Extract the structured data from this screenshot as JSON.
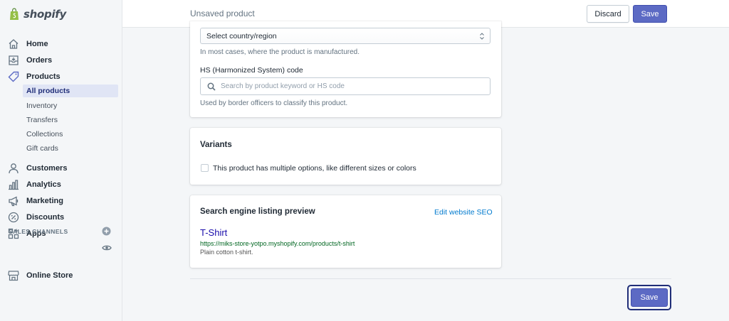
{
  "brand": {
    "name": "shopify",
    "color": "#95bf47"
  },
  "header": {
    "title": "Unsaved product",
    "discard_label": "Discard",
    "save_label": "Save"
  },
  "sidebar": {
    "items": [
      {
        "label": "Home",
        "icon": "home-icon"
      },
      {
        "label": "Orders",
        "icon": "orders-icon"
      },
      {
        "label": "Products",
        "icon": "tag-icon"
      },
      {
        "label": "Customers",
        "icon": "person-icon"
      },
      {
        "label": "Analytics",
        "icon": "bar-chart-icon"
      },
      {
        "label": "Marketing",
        "icon": "megaphone-icon"
      },
      {
        "label": "Discounts",
        "icon": "discount-icon"
      },
      {
        "label": "Apps",
        "icon": "apps-icon"
      }
    ],
    "product_subitems": [
      "All products",
      "Inventory",
      "Transfers",
      "Collections",
      "Gift cards"
    ],
    "active_subitem": "All products",
    "sales_channels_header": "SALES CHANNELS",
    "online_store_label": "Online Store"
  },
  "customs": {
    "country_select_value": "Select country/region",
    "country_help": "In most cases, where the product is manufactured.",
    "hs_label": "HS (Harmonized System) code",
    "hs_placeholder": "Search by product keyword or HS code",
    "hs_help": "Used by border officers to classify this product."
  },
  "variants": {
    "title": "Variants",
    "checkbox_label": "This product has multiple options, like different sizes or colors",
    "checked": false
  },
  "seo": {
    "title": "Search engine listing preview",
    "edit_link": "Edit website SEO",
    "preview_title": "T-Shirt",
    "preview_url": "https://miks-store-yotpo.myshopify.com/products/t-shirt",
    "preview_description": "Plain cotton t-shirt."
  },
  "footer": {
    "save_label": "Save"
  },
  "colors": {
    "primary": "#5c6ac4",
    "link": "#007ace",
    "active_nav_bg": "#e0e5f5"
  }
}
